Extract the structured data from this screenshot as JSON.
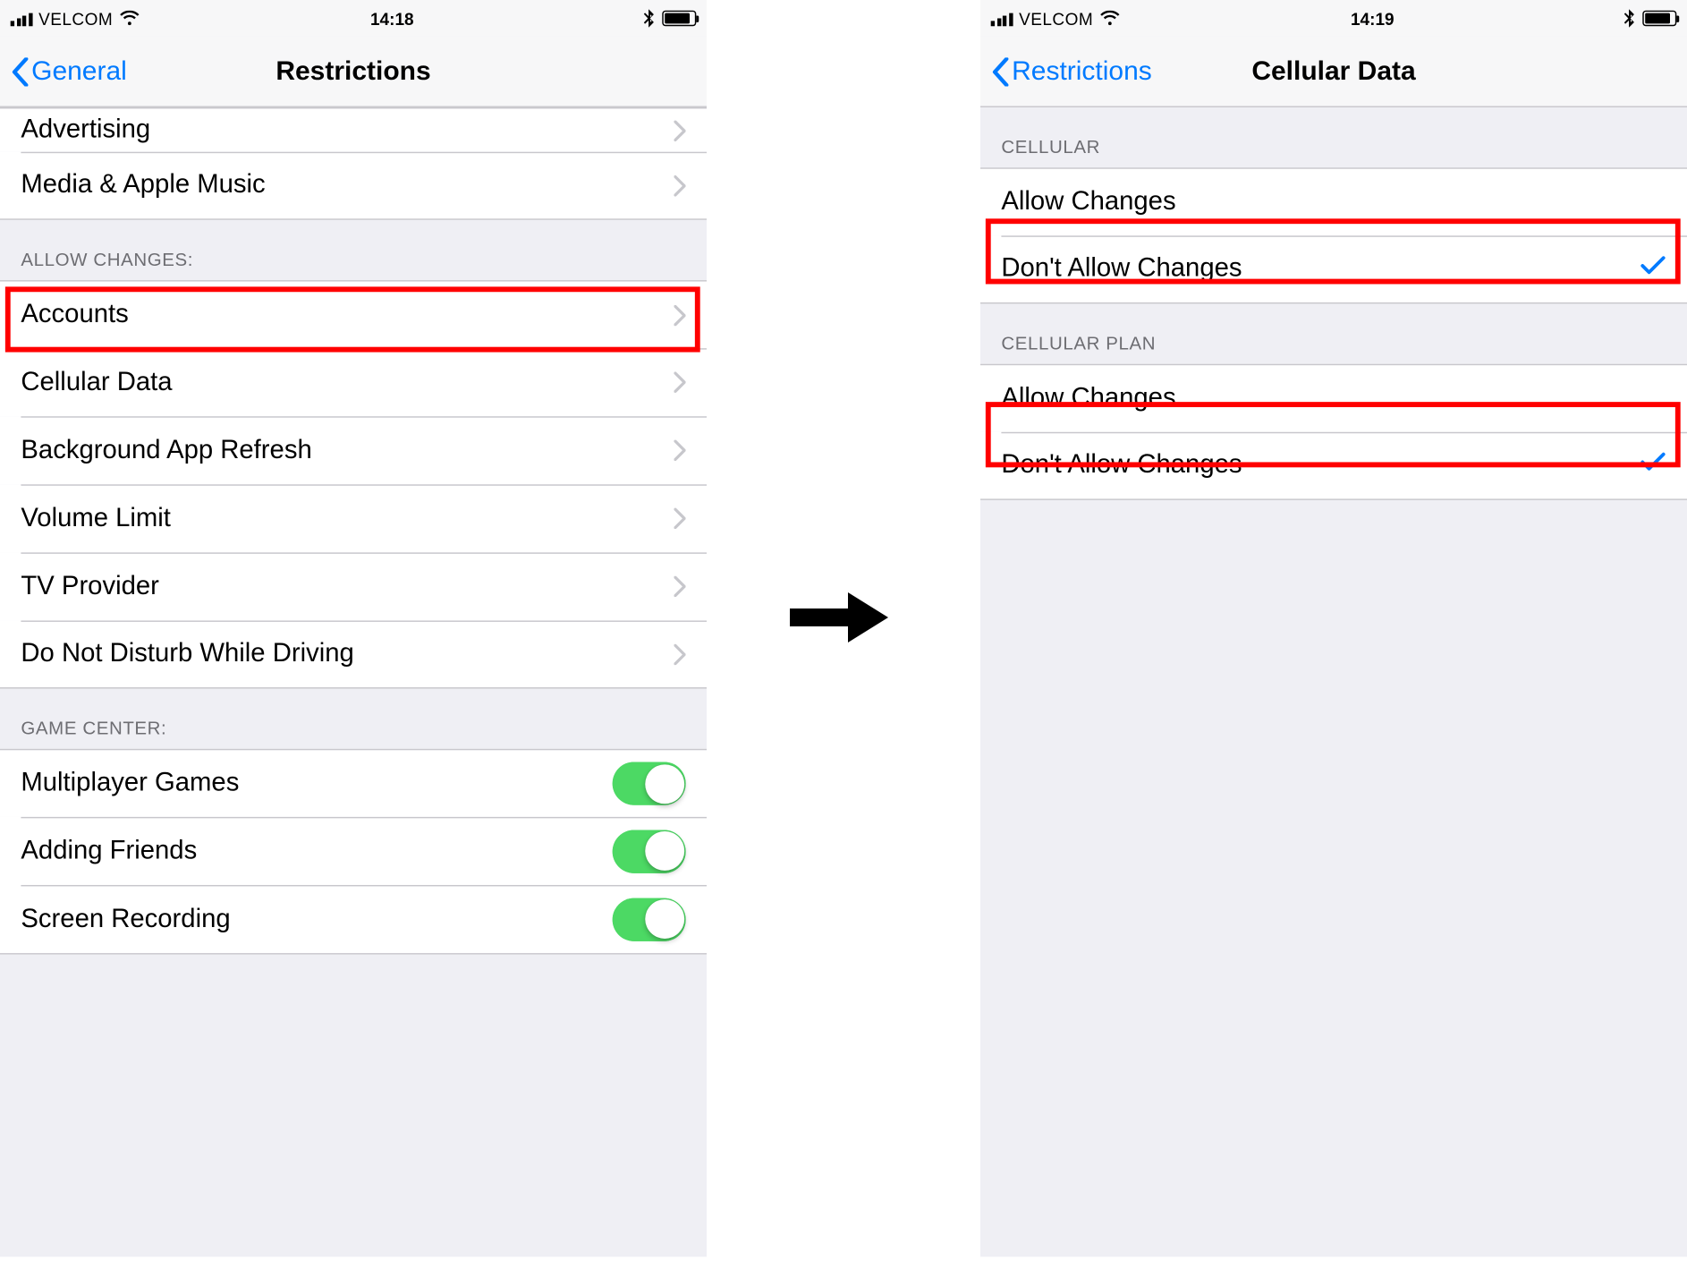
{
  "left": {
    "status": {
      "carrier": "VELCOM",
      "time": "14:18"
    },
    "nav": {
      "back": "General",
      "title": "Restrictions"
    },
    "group0": {
      "items": [
        {
          "label": "Advertising"
        },
        {
          "label": "Media & Apple Music"
        }
      ]
    },
    "group1": {
      "header": "ALLOW CHANGES:",
      "items": [
        {
          "label": "Accounts"
        },
        {
          "label": "Cellular Data"
        },
        {
          "label": "Background App Refresh"
        },
        {
          "label": "Volume Limit"
        },
        {
          "label": "TV Provider"
        },
        {
          "label": "Do Not Disturb While Driving"
        }
      ]
    },
    "group2": {
      "header": "GAME CENTER:",
      "items": [
        {
          "label": "Multiplayer Games"
        },
        {
          "label": "Adding Friends"
        },
        {
          "label": "Screen Recording"
        }
      ]
    }
  },
  "right": {
    "status": {
      "carrier": "VELCOM",
      "time": "14:19"
    },
    "nav": {
      "back": "Restrictions",
      "title": "Cellular Data"
    },
    "section1": {
      "header": "CELLULAR",
      "items": [
        {
          "label": "Allow Changes"
        },
        {
          "label": "Don't Allow Changes"
        }
      ]
    },
    "section2": {
      "header": "CELLULAR PLAN",
      "items": [
        {
          "label": "Allow Changes"
        },
        {
          "label": "Don't Allow Changes"
        }
      ]
    }
  }
}
